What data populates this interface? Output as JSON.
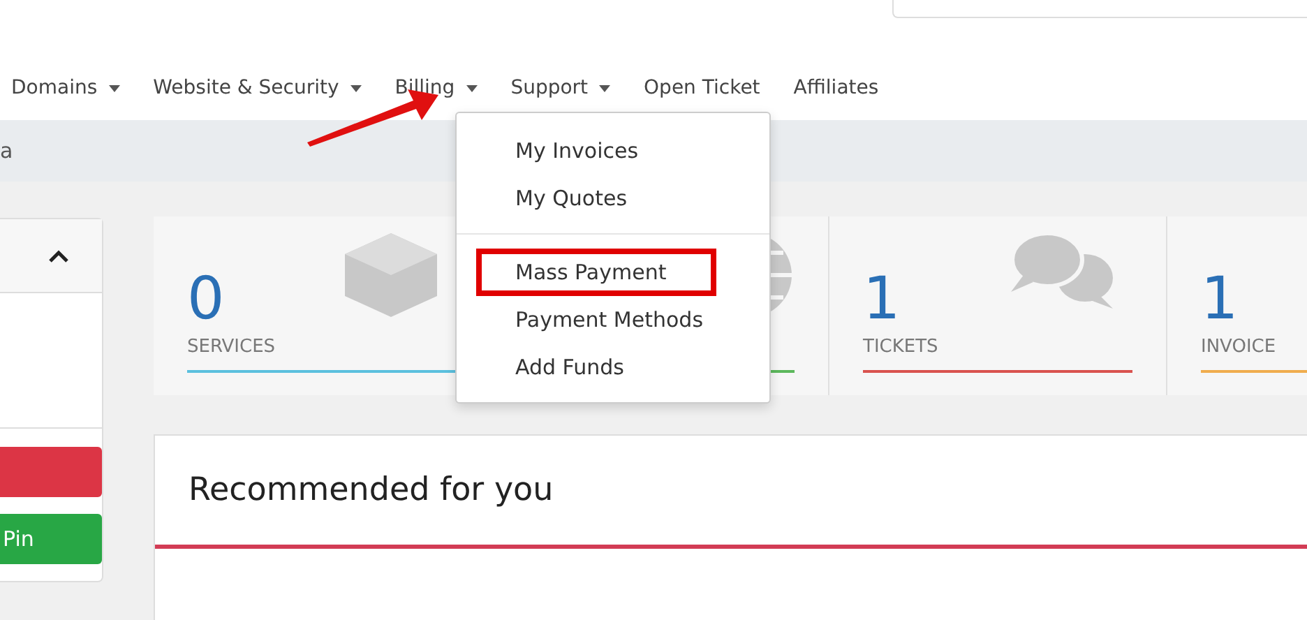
{
  "nav": [
    {
      "label": "Domains",
      "caret": true,
      "open": false
    },
    {
      "label": "Website & Security",
      "caret": true,
      "open": false
    },
    {
      "label": "Billing",
      "caret": true,
      "open": true
    },
    {
      "label": "Support",
      "caret": true,
      "open": false
    },
    {
      "label": "Open Ticket",
      "caret": false,
      "open": false
    },
    {
      "label": "Affiliates",
      "caret": false,
      "open": false
    }
  ],
  "billing_menu": [
    [
      {
        "label": "My Invoices",
        "highlighted": false
      },
      {
        "label": "My Quotes",
        "highlighted": false
      }
    ],
    [
      {
        "label": "Mass Payment",
        "highlighted": true
      },
      {
        "label": "Payment Methods",
        "highlighted": false
      },
      {
        "label": "Add Funds",
        "highlighted": false
      }
    ]
  ],
  "breadcrumb": "a",
  "side_panel": {
    "expanded": true,
    "buttons": [
      {
        "color": "#dc3545"
      },
      {
        "label": "Pin",
        "color": "#28a745"
      }
    ]
  },
  "tiles": [
    {
      "kind": "box",
      "value": "0",
      "label": "SERVICES",
      "color": "#5bc0de"
    },
    {
      "kind": "globe",
      "color": "#5cb85c"
    },
    {
      "kind": "chat",
      "value": "1",
      "label": "TICKETS",
      "color": "#d9534f"
    },
    {
      "kind": "none",
      "value": "1",
      "label": "INVOICE",
      "color": "#f0ad4e"
    }
  ],
  "recommended": {
    "title": "Recommended for you"
  }
}
